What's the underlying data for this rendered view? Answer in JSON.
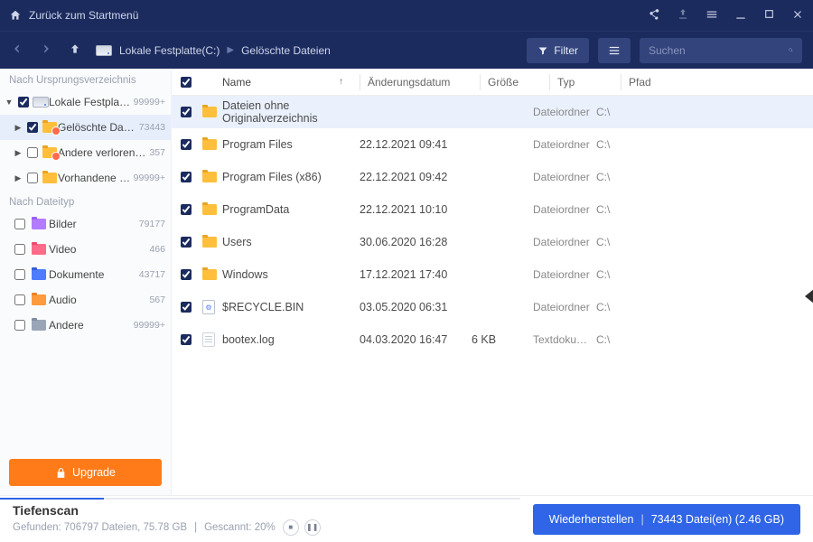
{
  "titlebar": {
    "back_label": "Zurück zum Startmenü"
  },
  "breadcrumb": {
    "drive": "Lokale Festplatte(C:)",
    "folder": "Gelöschte Dateien"
  },
  "toolbar": {
    "filter_label": "Filter",
    "search_placeholder": "Suchen"
  },
  "sidebar": {
    "section_origin": "Nach Ursprungsverzeichnis",
    "section_type": "Nach Dateityp",
    "drive": {
      "label": "Lokale Festplatte(C:)",
      "count": "99999+"
    },
    "subs": [
      {
        "label": "Gelöschte Dateien",
        "count": "73443",
        "selected": true,
        "badge": "del"
      },
      {
        "label": "Andere verlorene Date…",
        "count": "357",
        "badge": "del"
      },
      {
        "label": "Vorhandene Dateien",
        "count": "99999+",
        "badge": "plain"
      }
    ],
    "cats": [
      {
        "label": "Bilder",
        "count": "79177",
        "class": "cat-img"
      },
      {
        "label": "Video",
        "count": "466",
        "class": "cat-vid"
      },
      {
        "label": "Dokumente",
        "count": "43717",
        "class": "cat-doc"
      },
      {
        "label": "Audio",
        "count": "567",
        "class": "cat-aud"
      },
      {
        "label": "Andere",
        "count": "99999+",
        "class": "cat-oth"
      }
    ],
    "upgrade_label": "Upgrade"
  },
  "table": {
    "headers": {
      "name": "Name",
      "date": "Änderungsdatum",
      "size": "Größe",
      "type": "Typ",
      "path": "Pfad"
    },
    "rows": [
      {
        "name": "Dateien ohne Originalverzeichnis",
        "date": "",
        "size": "",
        "type": "Dateiordner",
        "path": "C:\\",
        "kind": "folder",
        "sel": true
      },
      {
        "name": "Program Files",
        "date": "22.12.2021 09:41",
        "size": "",
        "type": "Dateiordner",
        "path": "C:\\",
        "kind": "folder"
      },
      {
        "name": "Program Files (x86)",
        "date": "22.12.2021 09:42",
        "size": "",
        "type": "Dateiordner",
        "path": "C:\\",
        "kind": "folder"
      },
      {
        "name": "ProgramData",
        "date": "22.12.2021 10:10",
        "size": "",
        "type": "Dateiordner",
        "path": "C:\\",
        "kind": "folder"
      },
      {
        "name": "Users",
        "date": "30.06.2020 16:28",
        "size": "",
        "type": "Dateiordner",
        "path": "C:\\",
        "kind": "folder"
      },
      {
        "name": "Windows",
        "date": "17.12.2021 17:40",
        "size": "",
        "type": "Dateiordner",
        "path": "C:\\",
        "kind": "folder"
      },
      {
        "name": "$RECYCLE.BIN",
        "date": "03.05.2020 06:31",
        "size": "",
        "type": "Dateiordner",
        "path": "C:\\",
        "kind": "sys"
      },
      {
        "name": "bootex.log",
        "date": "04.03.2020 16:47",
        "size": "6 KB",
        "type": "Textdoku…",
        "path": "C:\\",
        "kind": "txt"
      }
    ]
  },
  "footer": {
    "scan_title": "Tiefenscan",
    "scan_sub_a": "Gefunden: 706797 Dateien, 75.78 GB",
    "scan_sub_b": "Gescannt: 20%",
    "recover_label": "Wiederherstellen",
    "recover_meta": "73443 Datei(en) (2.46 GB)"
  }
}
